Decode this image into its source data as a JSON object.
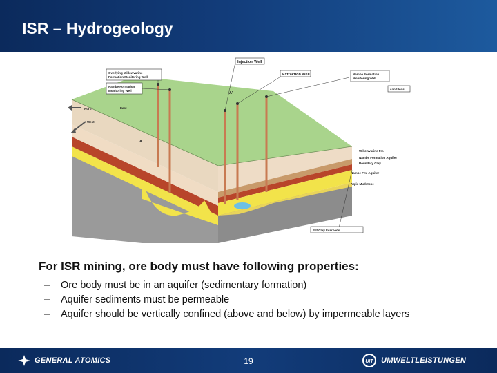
{
  "slide": {
    "title": "ISR – Hydrogeology",
    "page_number": "19"
  },
  "figure": {
    "labels": {
      "injection_well": "Injection Well",
      "extraction_well": "Extraction Well",
      "overlying_monitor": [
        "Overlying Willowvarine",
        "Formation Monitoring Well"
      ],
      "nambe_monitor_left": [
        "Nambe Formation",
        "Monitoring Well"
      ],
      "nambe_monitor_right": [
        "Nambe Formation",
        "Monitoring Well"
      ],
      "sand_lens": "sand lens",
      "north": "North",
      "east": "East",
      "west": "West",
      "marker_a": "A",
      "marker_a_prime": "A'",
      "silt_clay": "Silt/Clay Interbeds",
      "layer_1": "Willowvarine Fm.",
      "layer_2": "Nambe Formation Aquifer",
      "layer_3": "Boundary Clay",
      "layer_4": "Nambe Fm. Aquifer",
      "layer_5": "Aquitard",
      "layer_6": "Aqtic Mudstone"
    }
  },
  "content": {
    "heading": "For ISR mining, ore body must have following properties:",
    "bullets": [
      "Ore body must be in an aquifer (sedimentary formation)",
      "Aquifer sediments must be permeable",
      "Aquifer should be vertically confined (above and below) by impermeable layers"
    ],
    "dash": "–"
  },
  "footer": {
    "left_logo": "GENERAL ATOMICS",
    "right_logo": "UMWELTLEISTUNGEN",
    "right_mark": "UIT"
  },
  "colors": {
    "header_blue": "#123c7a",
    "surface_green": "#a9d48c",
    "sand_yellow": "#f2e34a",
    "clay_red": "#b8452a",
    "mudstone_gray": "#9a9a9a"
  }
}
